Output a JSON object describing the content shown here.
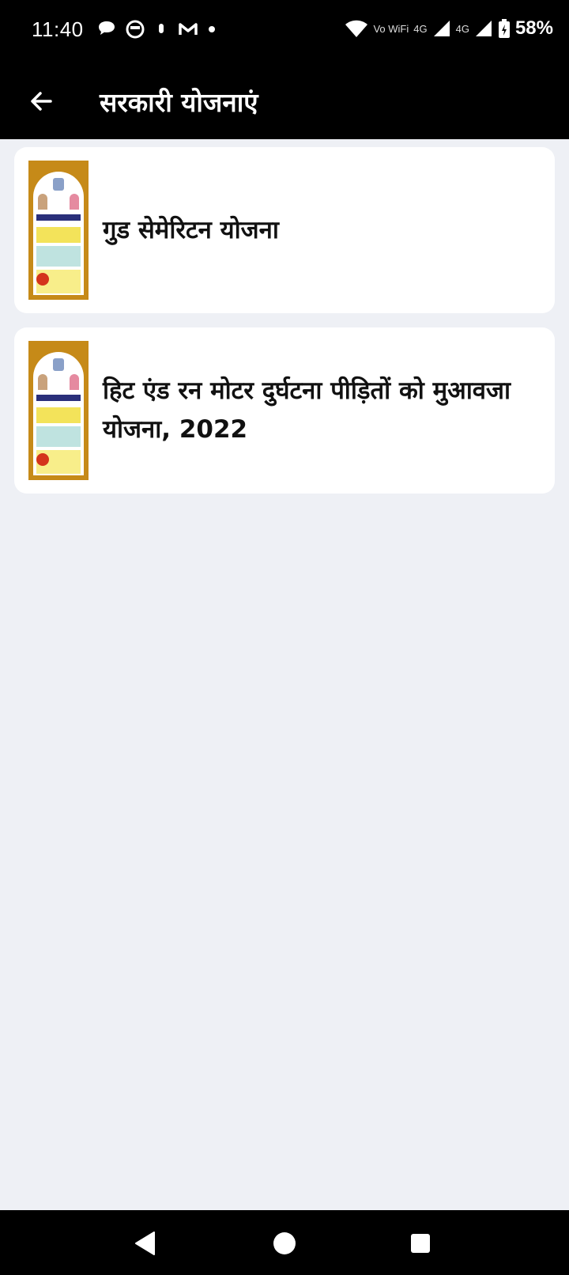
{
  "status_bar": {
    "time": "11:40",
    "battery": "58%",
    "network_labels": [
      "Vo WiFi",
      "4G",
      "4G"
    ],
    "notification_icons": [
      "chat-bubble-icon",
      "face-icon",
      "mic-icon",
      "gmail-icon",
      "dot-icon"
    ],
    "status_icons": [
      "wifi-icon",
      "signal-icon",
      "signal-icon",
      "battery-charging-icon"
    ]
  },
  "app_bar": {
    "title": "सरकारी योजनाएं",
    "back_icon": "arrow-left-icon"
  },
  "schemes": [
    {
      "title": "गुड सेमेरिटन योजना"
    },
    {
      "title": "हिट एंड रन मोटर दुर्घटना पीड़ितों को मुआवजा योजना, 2022"
    }
  ],
  "nav_bar": {
    "buttons": [
      "back-triangle-icon",
      "home-circle-icon",
      "recents-square-icon"
    ]
  },
  "colors": {
    "bars": "#000000",
    "background": "#eef0f5",
    "card": "#ffffff",
    "thumbnail_accent": "#c68a18"
  }
}
